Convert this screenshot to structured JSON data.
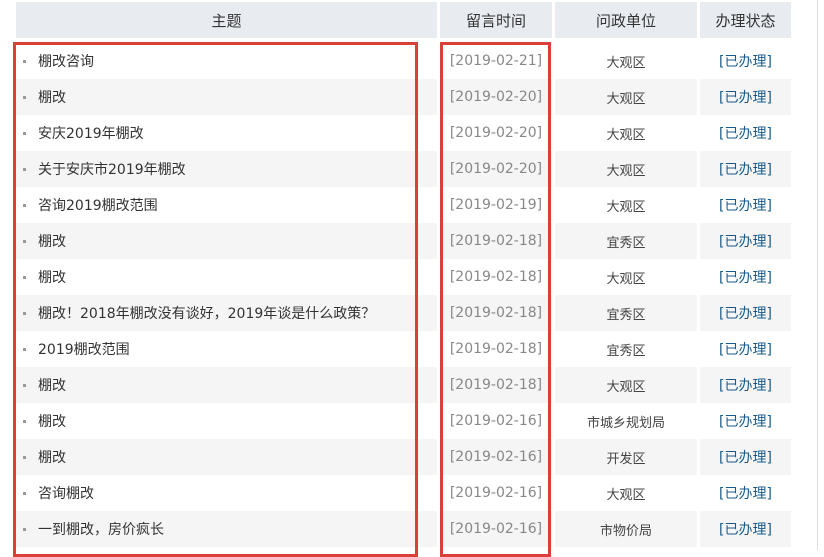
{
  "table": {
    "headers": {
      "subject": "主题",
      "time": "留言时间",
      "unit": "问政单位",
      "status": "办理状态"
    },
    "rows": [
      {
        "subject": "棚改咨询",
        "time": "[2019-02-21]",
        "unit": "大观区",
        "status": "[已办理]"
      },
      {
        "subject": "棚改",
        "time": "[2019-02-20]",
        "unit": "大观区",
        "status": "[已办理]"
      },
      {
        "subject": "安庆2019年棚改",
        "time": "[2019-02-20]",
        "unit": "大观区",
        "status": "[已办理]"
      },
      {
        "subject": "关于安庆市2019年棚改",
        "time": "[2019-02-20]",
        "unit": "大观区",
        "status": "[已办理]"
      },
      {
        "subject": "咨询2019棚改范围",
        "time": "[2019-02-19]",
        "unit": "大观区",
        "status": "[已办理]"
      },
      {
        "subject": "棚改",
        "time": "[2019-02-18]",
        "unit": "宜秀区",
        "status": "[已办理]"
      },
      {
        "subject": "棚改",
        "time": "[2019-02-18]",
        "unit": "大观区",
        "status": "[已办理]"
      },
      {
        "subject": "棚改！2018年棚改没有谈好，2019年谈是什么政策？",
        "time": "[2019-02-18]",
        "unit": "宜秀区",
        "status": "[已办理]"
      },
      {
        "subject": "2019棚改范围",
        "time": "[2019-02-18]",
        "unit": "宜秀区",
        "status": "[已办理]"
      },
      {
        "subject": "棚改",
        "time": "[2019-02-18]",
        "unit": "大观区",
        "status": "[已办理]"
      },
      {
        "subject": "棚改",
        "time": "[2019-02-16]",
        "unit": "市城乡规划局",
        "status": "[已办理]"
      },
      {
        "subject": "棚改",
        "time": "[2019-02-16]",
        "unit": "开发区",
        "status": "[已办理]"
      },
      {
        "subject": "咨询棚改",
        "time": "[2019-02-16]",
        "unit": "大观区",
        "status": "[已办理]"
      },
      {
        "subject": "一到棚改，房价疯长",
        "time": "[2019-02-16]",
        "unit": "市物价局",
        "status": "[已办理]"
      }
    ]
  },
  "colors": {
    "highlight": "#d9403a",
    "status_link": "#1a5a8a",
    "header_bg": "#e8ecf0"
  }
}
